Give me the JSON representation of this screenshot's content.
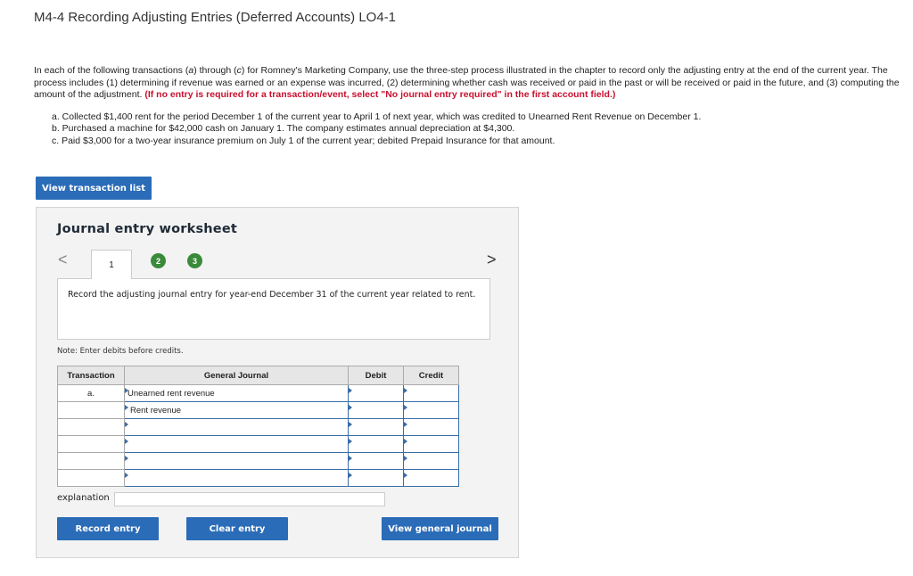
{
  "title": "M4-4 Recording Adjusting Entries (Deferred Accounts) LO4-1",
  "intro": {
    "text_a": "In each of the following transactions (",
    "a": "a",
    "text_b": ") through (",
    "c": "c",
    "text_c": ") for Romney's Marketing Company, use the three-step process illustrated in the chapter to record only the adjusting entry at the end of the current year. The process includes (1) determining if revenue was earned or an expense was incurred, (2) determining whether cash was received or paid in the past or will be received or paid in the future, and (3) computing the amount of the adjustment. ",
    "red": "(If no entry is required for a transaction/event, select \"No journal entry required\" in the first account field.)"
  },
  "items": [
    "a. Collected $1,400 rent for the period December 1 of the current year to April 1 of next year, which was credited to Unearned Rent Revenue on December 1.",
    "b. Purchased a machine for $42,000 cash on January 1. The company estimates annual depreciation at $4,300.",
    "c. Paid $3,000 for a two-year insurance premium on July 1 of the current year; debited Prepaid Insurance for that amount."
  ],
  "view_transaction_list": "View transaction list",
  "worksheet": {
    "title": "Journal entry worksheet",
    "prev": "<",
    "next": ">",
    "steps": [
      "1",
      "2",
      "3"
    ],
    "instruction": "Record the adjusting journal entry for year-end December 31 of the current year related to rent.",
    "note": "Note: Enter debits before credits."
  },
  "table": {
    "headers": {
      "transaction": "Transaction",
      "journal": "General Journal",
      "debit": "Debit",
      "credit": "Credit"
    },
    "rows": [
      {
        "transaction": "a.",
        "account": "Unearned rent revenue",
        "debit": "",
        "credit": ""
      },
      {
        "transaction": "",
        "account": "Rent revenue",
        "debit": "",
        "credit": ""
      },
      {
        "transaction": "",
        "account": "",
        "debit": "",
        "credit": ""
      },
      {
        "transaction": "",
        "account": "",
        "debit": "",
        "credit": ""
      },
      {
        "transaction": "",
        "account": "",
        "debit": "",
        "credit": ""
      },
      {
        "transaction": "",
        "account": "",
        "debit": "",
        "credit": ""
      }
    ]
  },
  "explanation_label": "explanation",
  "buttons": {
    "record": "Record entry",
    "clear": "Clear entry",
    "view_journal": "View general journal"
  },
  "colors": {
    "button_blue": "#2b6cb8",
    "step_green": "#3a8a3a",
    "required_red": "#c8102e"
  }
}
